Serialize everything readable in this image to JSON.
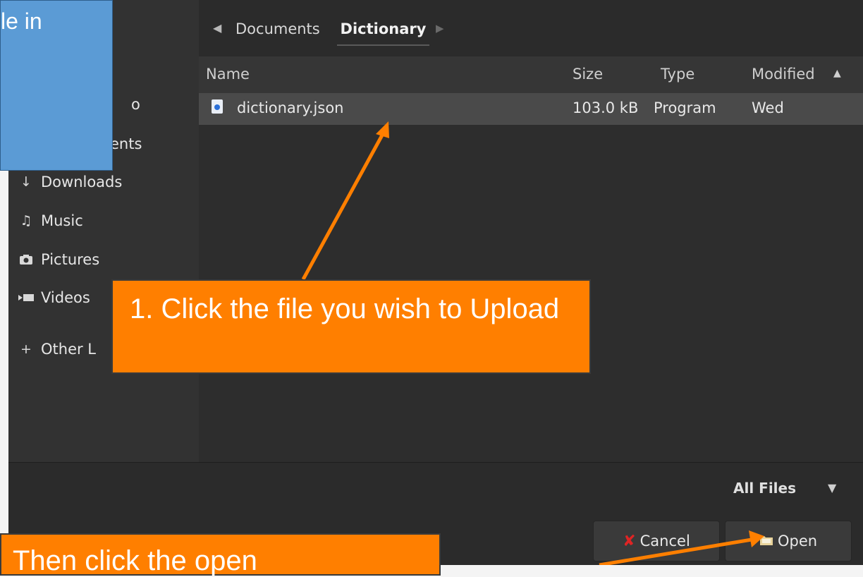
{
  "sidebar": {
    "items": [
      {
        "label": "o",
        "icon": ""
      },
      {
        "label": "ents",
        "icon": ""
      },
      {
        "label": "Downloads",
        "icon": "download-icon"
      },
      {
        "label": "Music",
        "icon": "music-icon"
      },
      {
        "label": "Pictures",
        "icon": "camera-icon"
      },
      {
        "label": "Videos",
        "icon": "video-icon"
      },
      {
        "label": "Other L",
        "icon": "plus-icon"
      }
    ]
  },
  "pathbar": {
    "crumbs": [
      "Documents",
      "Dictionary"
    ]
  },
  "filelist": {
    "columns": [
      "Name",
      "Size",
      "Type",
      "Modified"
    ],
    "rows": [
      {
        "name": "dictionary.json",
        "size": "103.0 kB",
        "type": "Program",
        "modified": "Wed"
      }
    ]
  },
  "filter": {
    "selected": "All Files"
  },
  "buttons": {
    "cancel": "Cancel",
    "open": "Open"
  },
  "annotations": {
    "blue_text": "le in",
    "step1": "1. Click the file you wish to Upload",
    "step2": "Then click the open"
  },
  "colors": {
    "accent_orange": "#ff7f00",
    "callout_blue": "#5b9bd5",
    "cancel_icon": "#e02424"
  }
}
